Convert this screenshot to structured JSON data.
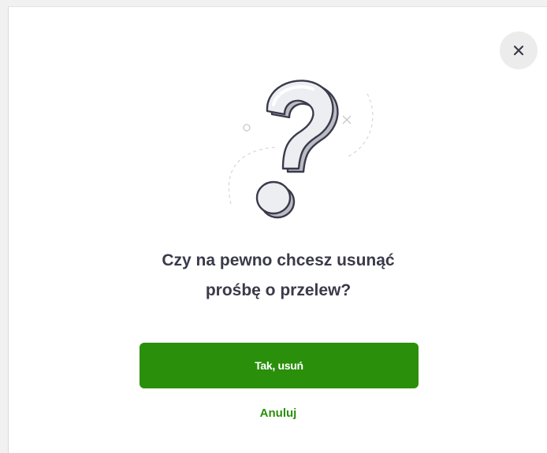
{
  "dialog": {
    "question_line1": "Czy na pewno chcesz usunąć",
    "question_line2": "prośbę o przelew?",
    "confirm_label": "Tak, usuń",
    "cancel_label": "Anuluj"
  },
  "icons": {
    "close": "close-icon",
    "illustration": "question-mark-icon"
  },
  "colors": {
    "primary": "#2a8f0b",
    "text": "#3a3a4a",
    "close_bg": "#ececec"
  }
}
